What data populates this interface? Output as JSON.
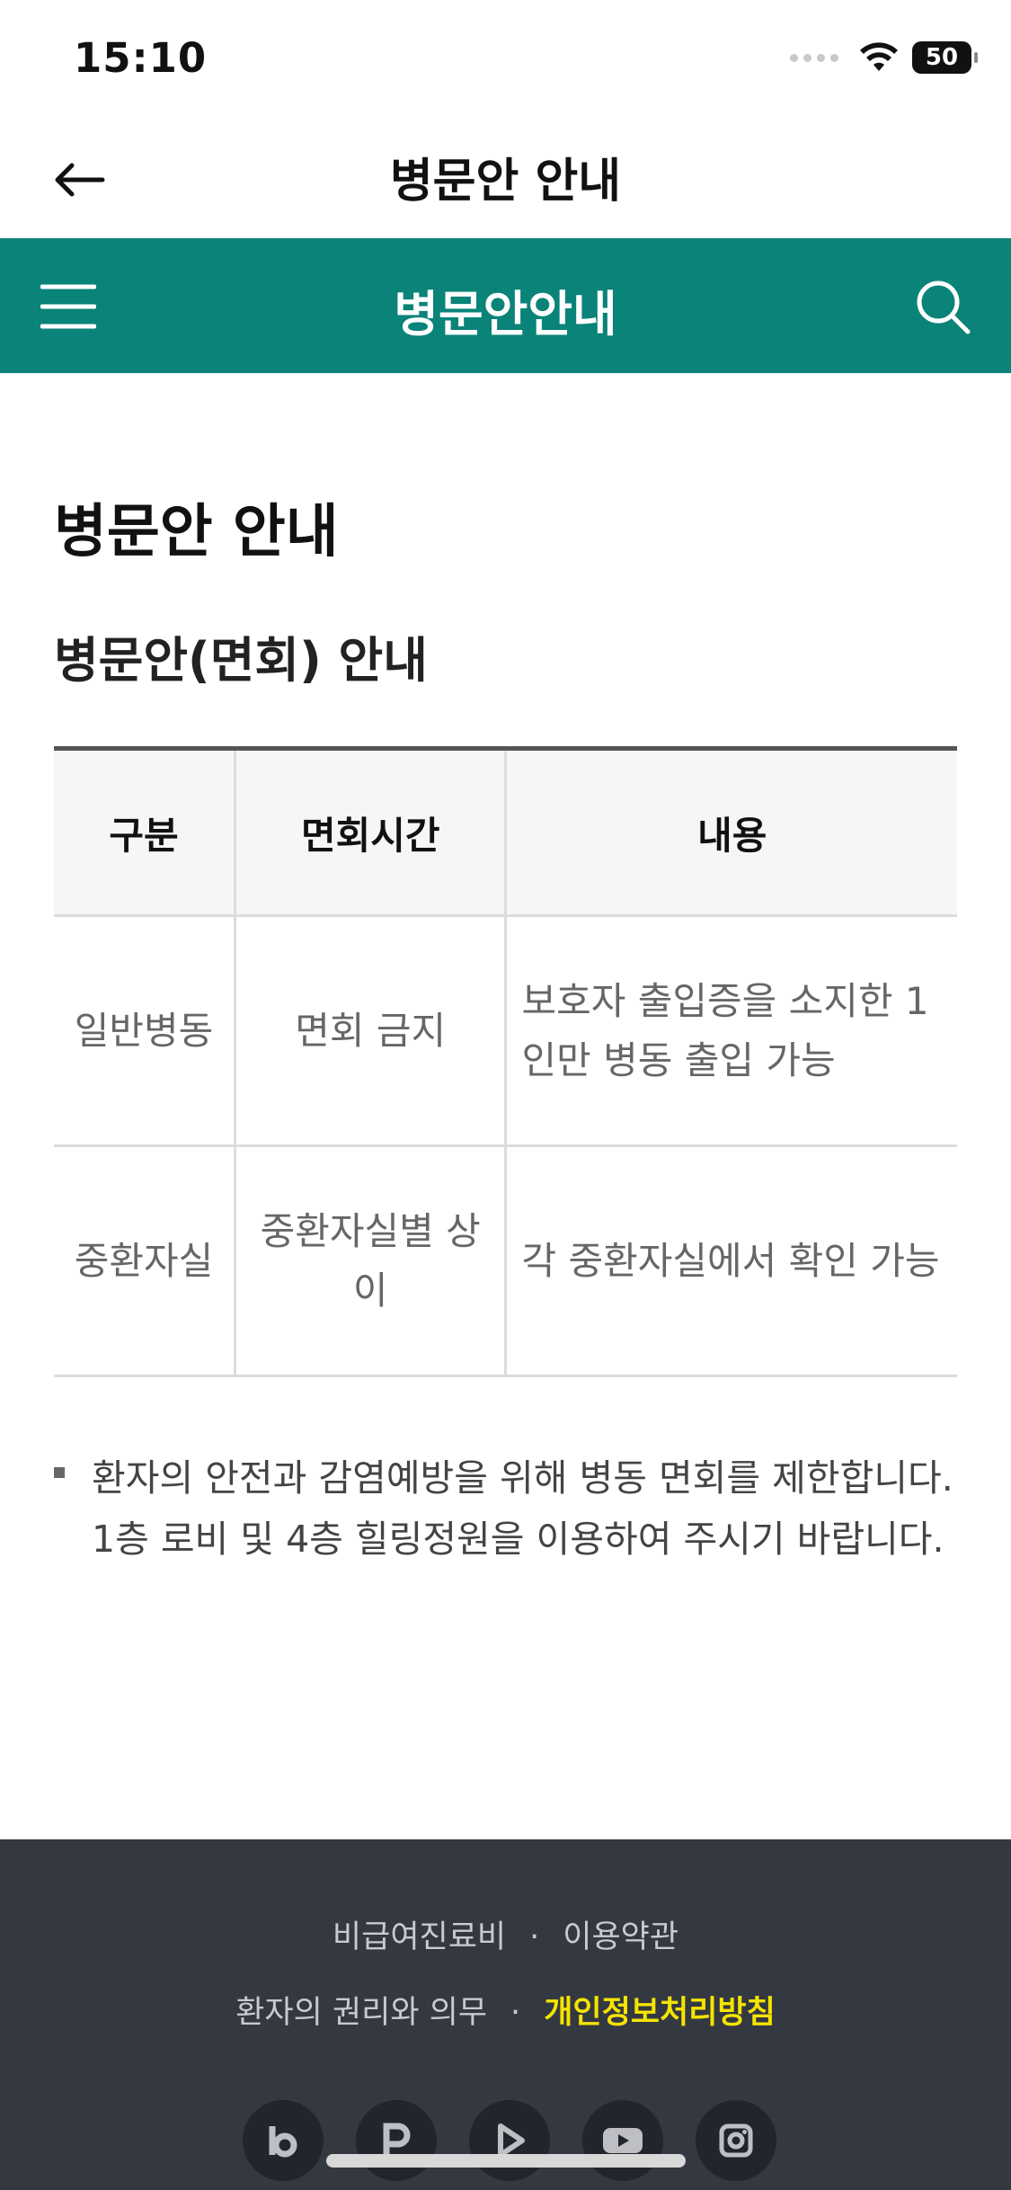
{
  "status": {
    "time": "15:10",
    "battery": "50"
  },
  "top_nav": {
    "title": "병문안 안내"
  },
  "header_bar": {
    "title": "병문안안내"
  },
  "page": {
    "heading": "병문안 안내",
    "section_heading": "병문안(면회) 안내"
  },
  "table": {
    "headers": [
      "구분",
      "면회시간",
      "내용"
    ],
    "rows": [
      [
        "일반병동",
        "면회 금지",
        "보호자 출입증을 소지한 1인만 병동 출입 가능"
      ],
      [
        "중환자실",
        "중환자실별 상이",
        "각 중환자실에서 확인 가능"
      ]
    ]
  },
  "notice": {
    "text": "환자의 안전과 감염예방을 위해 병동 면회를 제한합니다. 1층 로비 및 4층 힐링정원을 이용하여 주시기 바랍니다."
  },
  "footer": {
    "links_row1": [
      "비급여진료비",
      "이용약관"
    ],
    "links_row2": [
      "환자의 권리와 의무",
      "개인정보처리방침"
    ],
    "highlight_color": "#f5e400",
    "social_icons": [
      "blog-icon",
      "post-icon",
      "tv-icon",
      "youtube-icon",
      "instagram-icon"
    ]
  },
  "colors": {
    "header_bar": "#0a8379",
    "footer_bg": "#343841"
  }
}
